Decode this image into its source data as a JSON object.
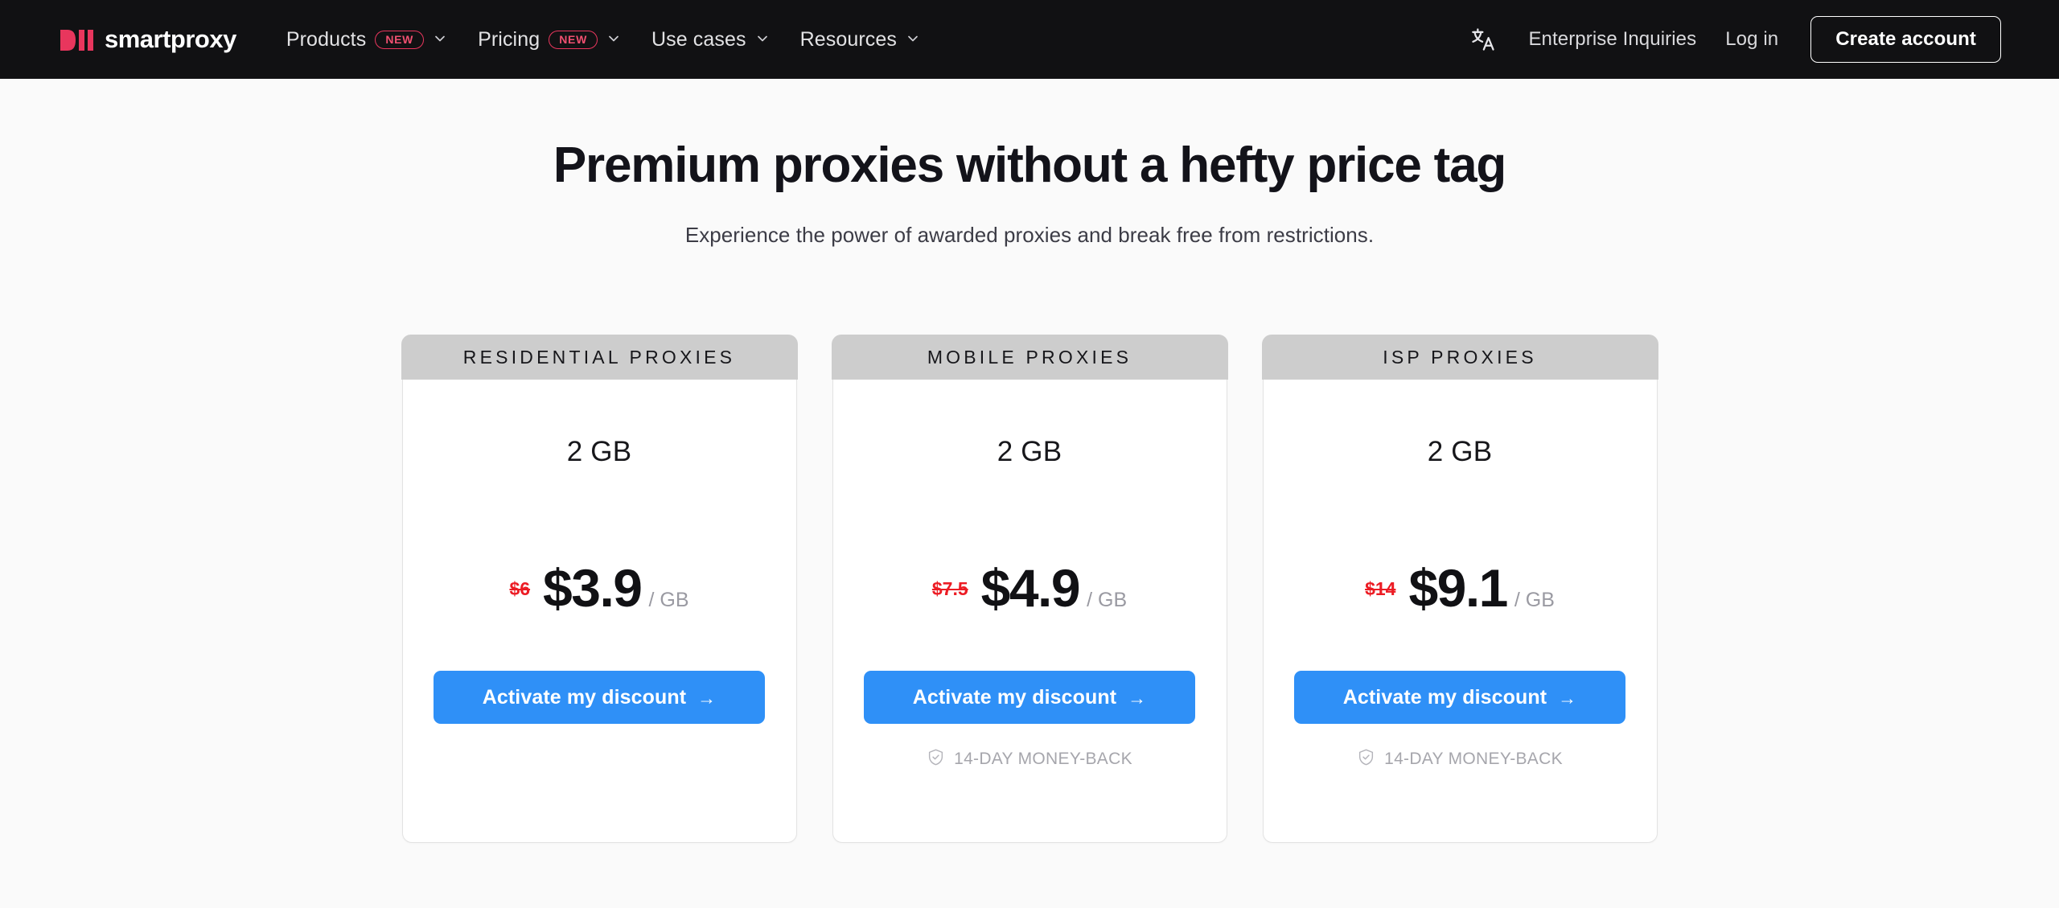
{
  "colors": {
    "nav_bg": "#111113",
    "page_bg": "#fafafa",
    "brand_red": "#e8365d",
    "cta_blue": "#2f90f7",
    "old_price_red": "#ec1c24",
    "card_header_gray": "#cdcdcd"
  },
  "nav": {
    "logo": {
      "text": "smartproxy",
      "mark_icon": "smartproxy-bars-logo"
    },
    "items": [
      {
        "label": "Products",
        "badge": "NEW",
        "has_chevron": true
      },
      {
        "label": "Pricing",
        "badge": "NEW",
        "has_chevron": true
      },
      {
        "label": "Use cases",
        "badge": "",
        "has_chevron": true
      },
      {
        "label": "Resources",
        "badge": "",
        "has_chevron": true
      }
    ],
    "right": {
      "language_icon": "translate-icon",
      "enterprise_label": "Enterprise Inquiries",
      "login_label": "Log in",
      "create_account_label": "Create account"
    }
  },
  "hero": {
    "title": "Premium proxies without a hefty price tag",
    "subtitle": "Experience the power of awarded proxies and break free from restrictions."
  },
  "cards": [
    {
      "header": "RESIDENTIAL PROXIES",
      "amount": "2 GB",
      "old_price": "$6",
      "new_price": "$3.9",
      "unit": "/ GB",
      "cta_label": "Activate my discount",
      "cta_arrow": "→",
      "guarantee": "",
      "has_guarantee": false
    },
    {
      "header": "MOBILE PROXIES",
      "amount": "2 GB",
      "old_price": "$7.5",
      "new_price": "$4.9",
      "unit": "/ GB",
      "cta_label": "Activate my discount",
      "cta_arrow": "→",
      "guarantee": "14-DAY MONEY-BACK",
      "has_guarantee": true
    },
    {
      "header": "ISP PROXIES",
      "amount": "2 GB",
      "old_price": "$14",
      "new_price": "$9.1",
      "unit": "/ GB",
      "cta_label": "Activate my discount",
      "cta_arrow": "→",
      "guarantee": "14-DAY MONEY-BACK",
      "has_guarantee": true
    }
  ]
}
